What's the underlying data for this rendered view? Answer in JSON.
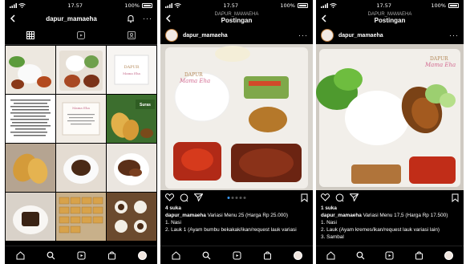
{
  "status": {
    "time": "17.57",
    "battery_pct": "100%"
  },
  "phone1": {
    "username": "dapur_mamaeha",
    "back_icon": "chevron-left-icon",
    "tabs": [
      "grid-icon",
      "reels-icon",
      "tagged-icon"
    ],
    "tile_texts": {
      "tile4": "Bismillah Dapur Mamaeha...",
      "tile6": "Suras Berkah"
    }
  },
  "phone2": {
    "header_sub": "DAPUR_MAMAEHA",
    "header_title": "Postingan",
    "username": "dapur_mamaeha",
    "likes": "4 suka",
    "caption_user": "dapur_mamaeha",
    "caption_text": "Variasi Menu 25 (Harga Rp 25.000)",
    "lines": [
      "1. Nasi",
      "2. Lauk 1 (Ayam bumbu bekakak/ikan/request lauk variasi"
    ]
  },
  "phone3": {
    "header_sub": "DAPUR_MAMAEHA",
    "header_title": "Postingan",
    "username": "dapur_mamaeha",
    "likes": "1 suka",
    "caption_user": "dapur_mamaeha",
    "caption_text": "Variasi Menu 17,5 (Harga Rp 17.500)",
    "lines": [
      "1. Nasi",
      "2. Lauk (Ayam kremes/ikan/request lauk variasi lain)",
      "3. Sambal"
    ]
  },
  "watermark": {
    "brand": "DAPUR",
    "script": "Mama Eha"
  },
  "colors": {
    "accent_blue": "#3897f0",
    "background": "#000000"
  }
}
